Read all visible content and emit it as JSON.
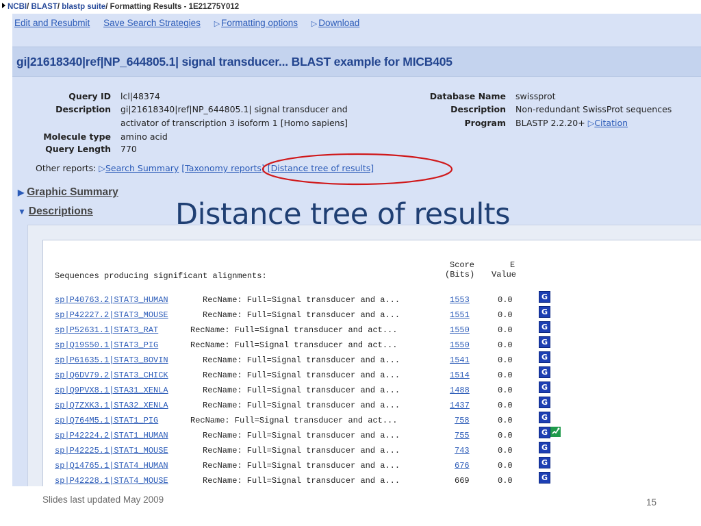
{
  "breadcrumb": {
    "ncbi": "NCBI",
    "blast": "BLAST",
    "suite": "blastp suite",
    "page": "Formatting Results - 1E21Z75Y012",
    "sep": "/"
  },
  "toolbar": {
    "edit": "Edit and Resubmit",
    "save": "Save Search Strategies",
    "formatting": "Formatting options",
    "download": "Download"
  },
  "title": "gi|21618340|ref|NP_644805.1| signal transducer... BLAST example for MICB405",
  "query": {
    "id_label": "Query ID",
    "id_value": "lcl|48374",
    "desc_label": "Description",
    "desc_line1": "gi|21618340|ref|NP_644805.1| signal transducer and",
    "desc_line2": "activator of transcription 3 isoform 1 [Homo sapiens]",
    "moltype_label": "Molecule type",
    "moltype_value": "amino acid",
    "len_label": "Query Length",
    "len_value": "770"
  },
  "database": {
    "name_label": "Database Name",
    "name_value": "swissprot",
    "desc_label": "Description",
    "desc_value": "Non-redundant SwissProt sequences",
    "program_label": "Program",
    "program_value": "BLASTP 2.2.20+",
    "citation": "Citation"
  },
  "other_reports": {
    "label": "Other reports:",
    "summary": "Search Summary",
    "taxonomy": "[Taxonomy reports]",
    "tree": "[Distance tree of results]"
  },
  "sections": {
    "graphic": "Graphic Summary",
    "descriptions": "Descriptions"
  },
  "annotation": "Distance tree of results",
  "results": {
    "heading": "Sequences producing significant alignments:",
    "score_h1": "Score",
    "score_h2": "(Bits)",
    "e_h1": "E",
    "e_h2": "Value",
    "rows": [
      {
        "acc": "sp|P40763.2|STAT3_HUMAN",
        "desc": "RecName: Full=Signal transducer and a...",
        "score": "1553",
        "e": "0.0"
      },
      {
        "acc": "sp|P42227.2|STAT3_MOUSE",
        "desc": "RecName: Full=Signal transducer and a...",
        "score": "1551",
        "e": "0.0"
      },
      {
        "acc": "sp|P52631.1|STAT3_RAT",
        "desc": "RecName: Full=Signal transducer and act...",
        "score": "1550",
        "e": "0.0"
      },
      {
        "acc": "sp|Q19S50.1|STAT3_PIG",
        "desc": "RecName: Full=Signal transducer and act...",
        "score": "1550",
        "e": "0.0"
      },
      {
        "acc": "sp|P61635.1|STAT3_BOVIN",
        "desc": "RecName: Full=Signal transducer and a...",
        "score": "1541",
        "e": "0.0"
      },
      {
        "acc": "sp|Q6DV79.2|STAT3_CHICK",
        "desc": "RecName: Full=Signal transducer and a...",
        "score": "1514",
        "e": "0.0"
      },
      {
        "acc": "sp|Q9PVX8.1|STA31_XENLA",
        "desc": "RecName: Full=Signal transducer and a...",
        "score": "1488",
        "e": "0.0"
      },
      {
        "acc": "sp|Q7ZXK3.1|STA32_XENLA",
        "desc": "RecName: Full=Signal transducer and a...",
        "score": "1437",
        "e": "0.0"
      },
      {
        "acc": "sp|Q764M5.1|STAT1_PIG",
        "desc": "RecName: Full=Signal transducer and act...",
        "score": "758",
        "e": "0.0"
      },
      {
        "acc": "sp|P42224.2|STAT1_HUMAN",
        "desc": "RecName: Full=Signal transducer and a...",
        "score": "755",
        "e": "0.0"
      },
      {
        "acc": "sp|P42225.1|STAT1_MOUSE",
        "desc": "RecName: Full=Signal transducer and a...",
        "score": "743",
        "e": "0.0"
      },
      {
        "acc": "sp|Q14765.1|STAT4_HUMAN",
        "desc": "RecName: Full=Signal transducer and a...",
        "score": "676",
        "e": "0.0"
      },
      {
        "acc": "sp|P42228.1|STAT4_MOUSE",
        "desc": "RecName: Full=Signal transducer and a...",
        "score": "669",
        "e": "0.0"
      }
    ]
  },
  "icons": {
    "gene": "G",
    "unigene": "U"
  },
  "footer": {
    "note": "Slides last updated May 2009",
    "page": "15"
  },
  "colors": {
    "link": "#2b5bb8",
    "panel": "#d8e2f6",
    "annotation": "#1f3f73",
    "oval": "#d0191b"
  }
}
